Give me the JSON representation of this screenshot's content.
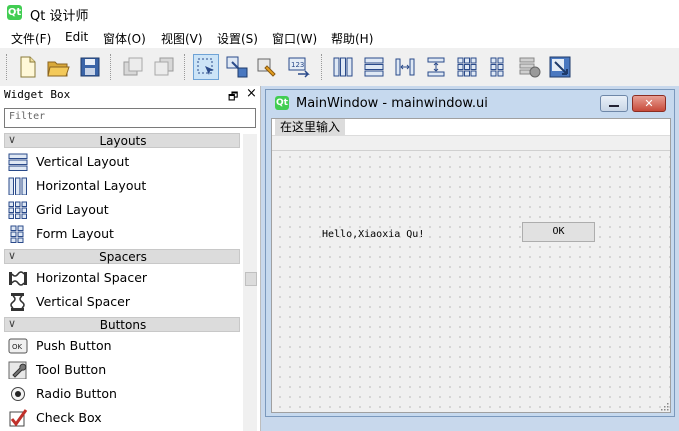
{
  "app": {
    "title": "Qt 设计师",
    "icon": "qt-logo-icon",
    "icon_text": "Qt"
  },
  "menubar": [
    {
      "label": "文件(F)"
    },
    {
      "label": "Edit"
    },
    {
      "label": "窗体(O)"
    },
    {
      "label": "视图(V)"
    },
    {
      "label": "设置(S)"
    },
    {
      "label": "窗口(W)"
    },
    {
      "label": "帮助(H)"
    }
  ],
  "toolbar": {
    "buttons": [
      "new-file-icon",
      "open-folder-icon",
      "save-icon",
      "send-to-back-icon",
      "bring-to-front-icon",
      "edit-widgets-icon",
      "edit-signals-slots-icon",
      "edit-buddies-icon",
      "edit-tab-order-icon",
      "layout-horizontal-icon",
      "layout-vertical-icon",
      "layout-horizontal-splitter-icon",
      "layout-vertical-splitter-icon",
      "layout-grid-icon",
      "layout-form-icon",
      "break-layout-icon",
      "adjust-size-icon"
    ],
    "active": "edit-widgets-icon"
  },
  "widget_box": {
    "title": "Widget Box",
    "filter_placeholder": "Filter",
    "float_glyph": "🗗",
    "close_glyph": "×",
    "chevron_glyph": "∨",
    "categories": [
      {
        "label": "Layouts",
        "items": [
          {
            "label": "Vertical Layout",
            "icon": "vertical-layout-icon"
          },
          {
            "label": "Horizontal Layout",
            "icon": "horizontal-layout-icon"
          },
          {
            "label": "Grid Layout",
            "icon": "grid-layout-icon"
          },
          {
            "label": "Form Layout",
            "icon": "form-layout-icon"
          }
        ]
      },
      {
        "label": "Spacers",
        "items": [
          {
            "label": "Horizontal Spacer",
            "icon": "horizontal-spacer-icon"
          },
          {
            "label": "Vertical Spacer",
            "icon": "vertical-spacer-icon"
          }
        ]
      },
      {
        "label": "Buttons",
        "items": [
          {
            "label": "Push Button",
            "icon": "push-button-icon"
          },
          {
            "label": "Tool Button",
            "icon": "tool-button-icon"
          },
          {
            "label": "Radio Button",
            "icon": "radio-button-icon"
          },
          {
            "label": "Check Box",
            "icon": "check-box-icon"
          }
        ]
      }
    ]
  },
  "form_window": {
    "title": "MainWindow - mainwindow.ui",
    "icon_text": "Qt",
    "close_glyph": "✕",
    "menu_placeholder": "在这里输入",
    "label_text": "Hello,Xiaoxia Qu!",
    "button_text": "OK"
  },
  "colors": {
    "selection": "#cce4f7",
    "close_button": "#c74a3a",
    "qt_green": "#41cd52",
    "mdi_background": "#c8d8ec"
  }
}
